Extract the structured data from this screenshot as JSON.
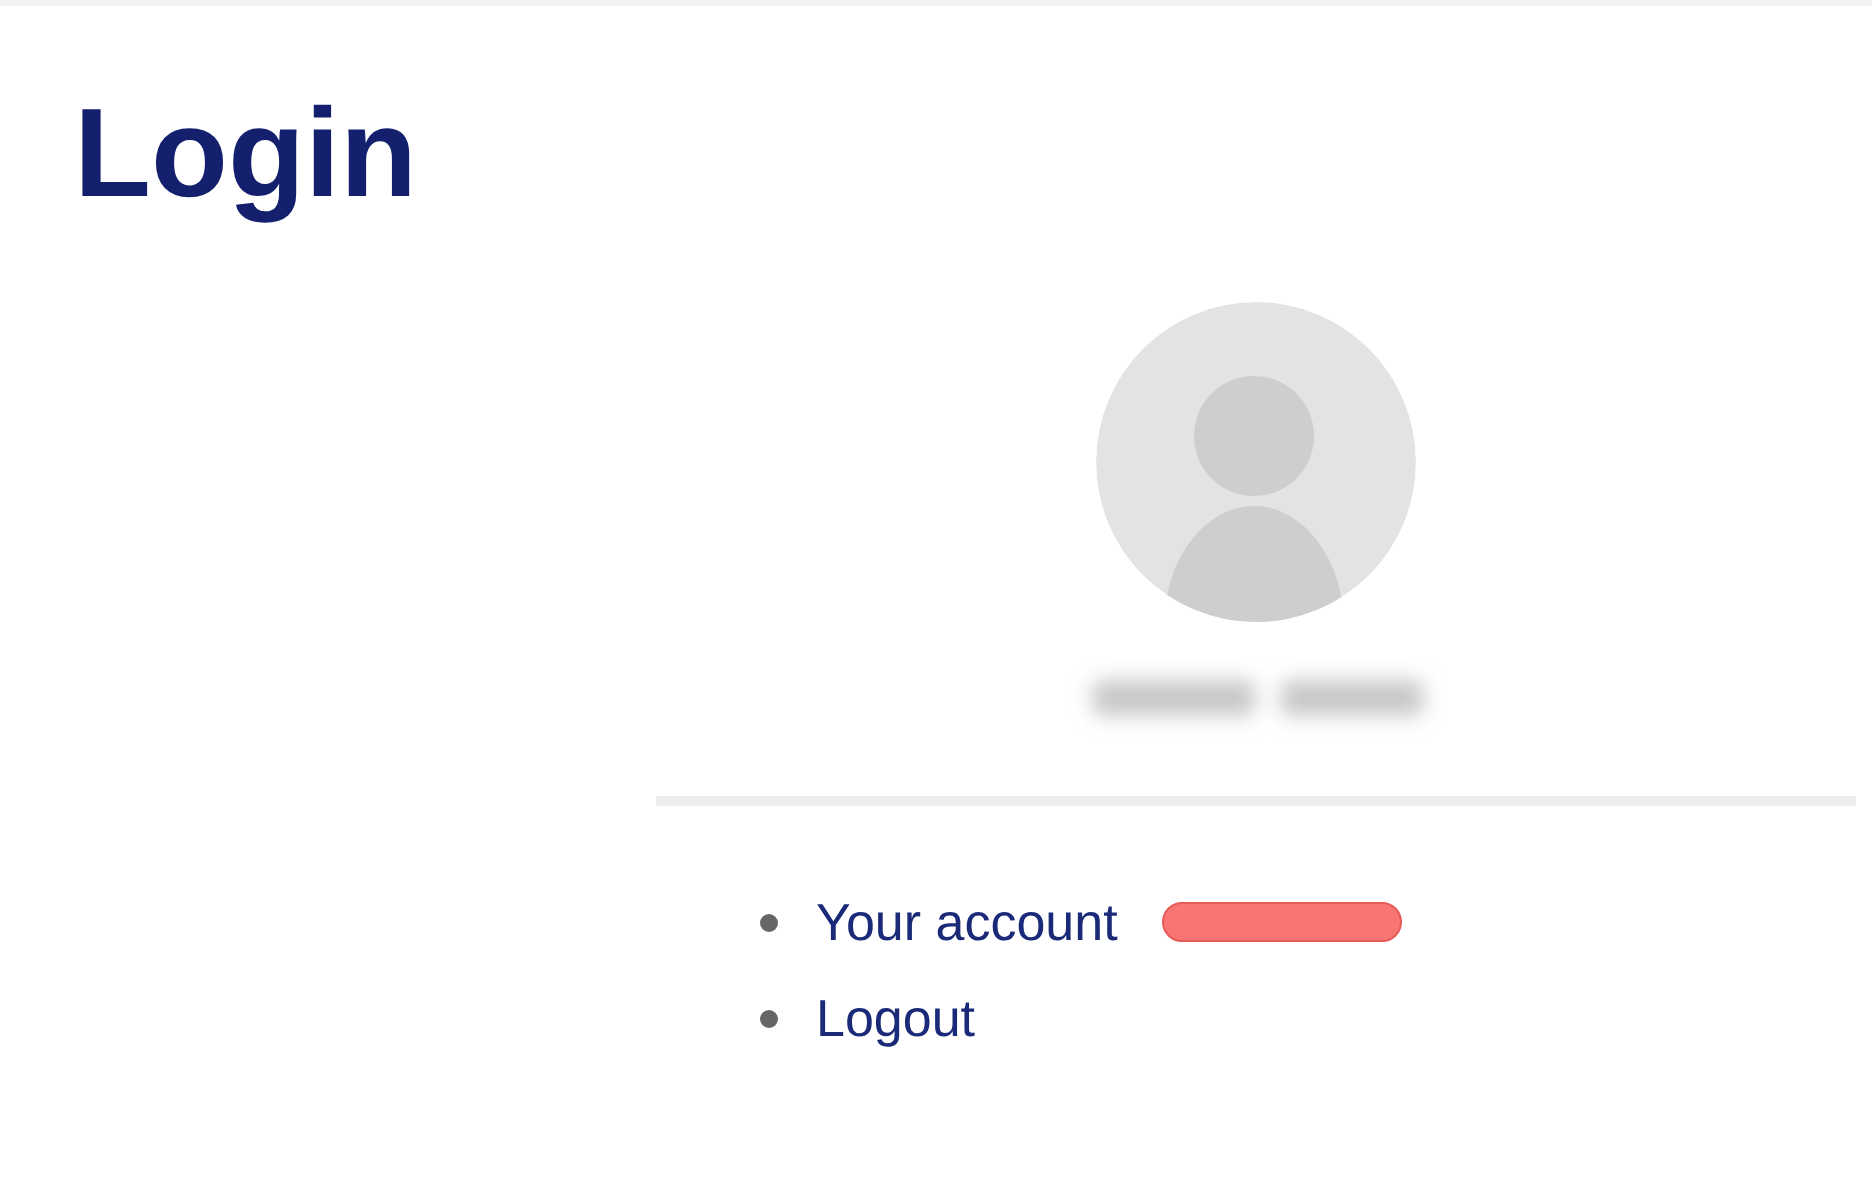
{
  "page_title": "Login",
  "menu": [
    {
      "label": "Your account",
      "has_badge": true
    },
    {
      "label": "Logout",
      "has_badge": false
    }
  ]
}
